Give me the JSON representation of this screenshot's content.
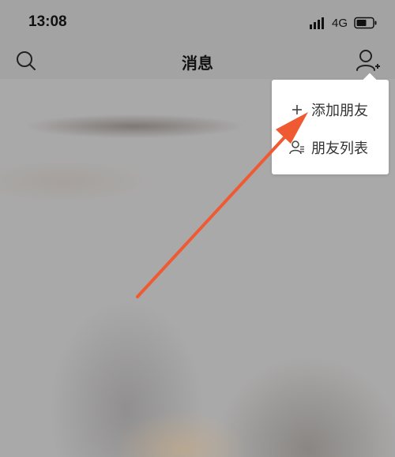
{
  "status": {
    "time": "13:08",
    "network": "4G"
  },
  "nav": {
    "title": "消息"
  },
  "menu": {
    "items": [
      {
        "label": "添加朋友",
        "icon": "plus-icon"
      },
      {
        "label": "朋友列表",
        "icon": "friend-list-icon"
      }
    ]
  },
  "colors": {
    "annotation_arrow": "#f05a33",
    "menu_bg": "#ffffff",
    "overlay": "#a9a9a9"
  }
}
